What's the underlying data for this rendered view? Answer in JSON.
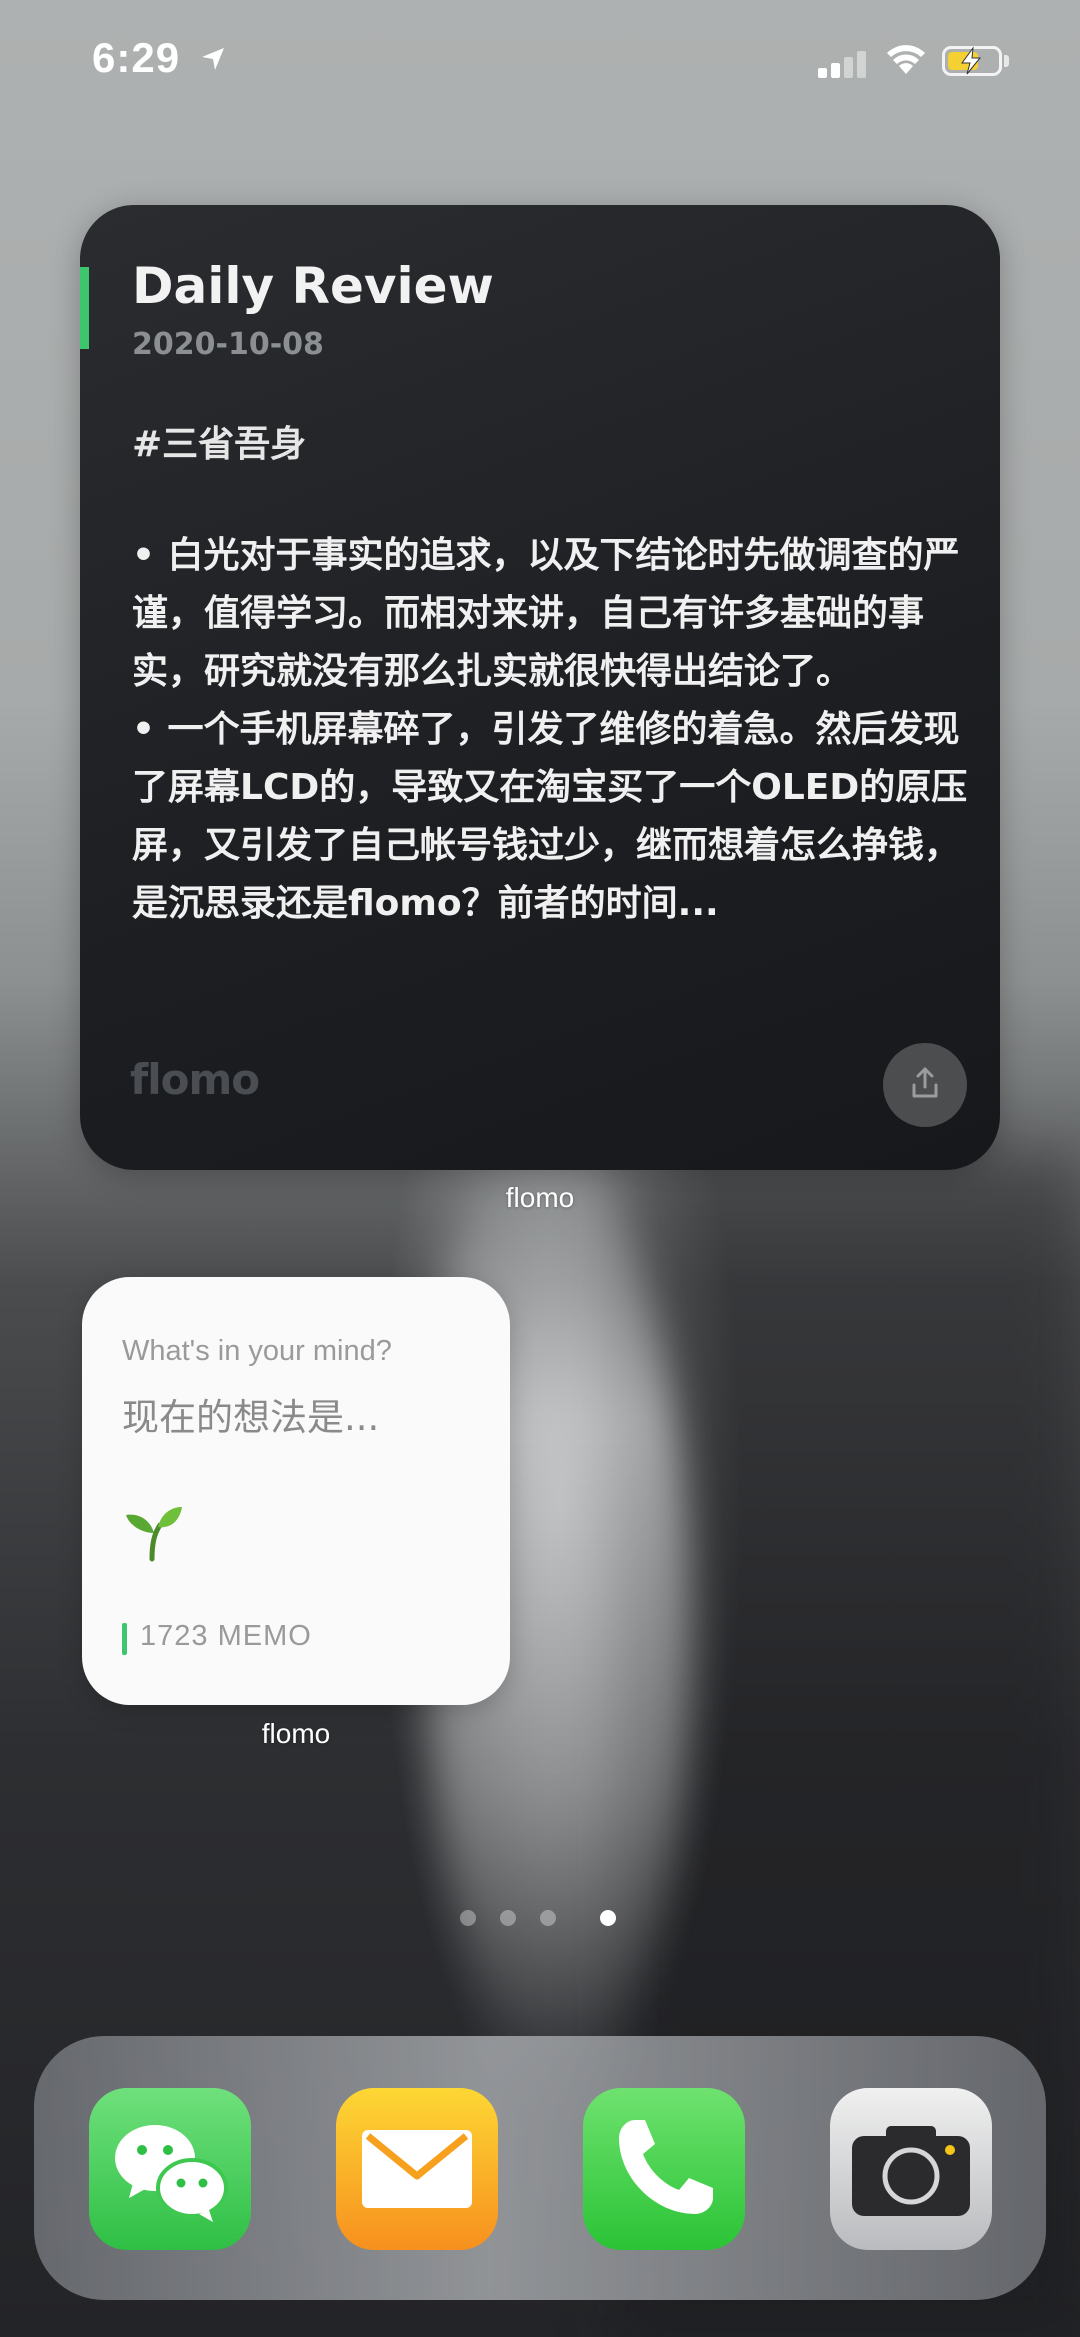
{
  "status_bar": {
    "time": "6:29",
    "battery_color": "#f5d033"
  },
  "review_widget": {
    "title": "Daily Review",
    "date": "2020-10-08",
    "tag": "#三省吾身",
    "paragraphs": [
      "• 白光对于事实的追求，以及下结论时先做调查的严谨，值得学习。而相对来讲，自己有许多基础的事实，研究就没有那么扎实就很快得出结论了。",
      "• 一个手机屏幕碎了，引发了维修的着急。然后发现了屏幕LCD的，导致又在淘宝买了一个OLED的原压屏，又引发了自己帐号钱过少，继而想着怎么挣钱，是沉思录还是flomo？前者的时间..."
    ],
    "logo": "flomo",
    "accent_color": "#3ec66f",
    "caption": "flomo"
  },
  "memo_widget": {
    "prompt_en": "What's in your mind?",
    "prompt_cn": "现在的想法是...",
    "count": "1723 MEMO",
    "caption": "flomo"
  },
  "page_dots": {
    "count": 4,
    "active_index": 3
  },
  "dock": {
    "apps": [
      {
        "name": "wechat-icon"
      },
      {
        "name": "mail-icon"
      },
      {
        "name": "phone-icon"
      },
      {
        "name": "camera-icon"
      }
    ]
  }
}
